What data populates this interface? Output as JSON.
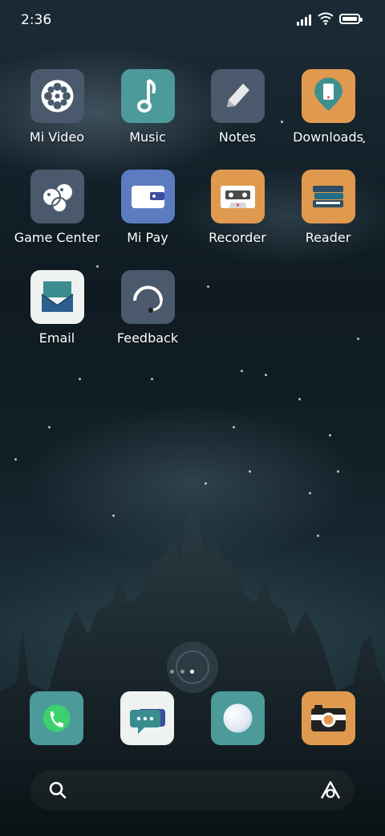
{
  "status_bar": {
    "time": "2:36"
  },
  "apps": [
    {
      "label": "Mi Video",
      "icon": "film-reel-icon"
    },
    {
      "label": "Music",
      "icon": "music-note-icon"
    },
    {
      "label": "Notes",
      "icon": "pencil-icon"
    },
    {
      "label": "Downloads",
      "icon": "download-pin-icon"
    },
    {
      "label": "Game Center",
      "icon": "game-bubbles-icon"
    },
    {
      "label": "Mi Pay",
      "icon": "wallet-icon"
    },
    {
      "label": "Recorder",
      "icon": "cassette-icon"
    },
    {
      "label": "Reader",
      "icon": "books-icon"
    },
    {
      "label": "Email",
      "icon": "envelope-icon"
    },
    {
      "label": "Feedback",
      "icon": "headset-icon"
    }
  ],
  "dock": [
    {
      "icon": "phone-icon"
    },
    {
      "icon": "chat-bubble-icon"
    },
    {
      "icon": "browser-sphere-icon"
    },
    {
      "icon": "camera-icon"
    }
  ],
  "page_indicator": {
    "pages": 3,
    "current": 3
  },
  "colors": {
    "slate": "#4a5a6c",
    "teal": "#4c9a9a",
    "orange": "#e09a4f",
    "blue": "#5b7cc0",
    "white": "#eef2f1",
    "phone_green": "#3ecf6e"
  }
}
